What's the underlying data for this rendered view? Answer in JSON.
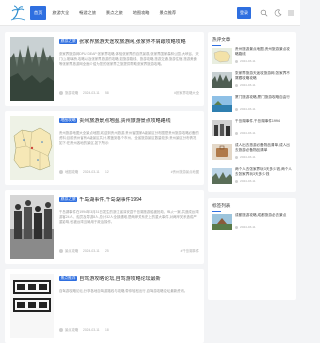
{
  "nav": {
    "items": [
      "首页",
      "旅游大全",
      "畅游之旅",
      "景点之旅",
      "地图攻略",
      "景点推荐"
    ],
    "login": "登录"
  },
  "posts": [
    {
      "category": "旅游之旅",
      "title": "张家界旅游天途攻旅游网,张家界不屑跟攻略攻略",
      "excerpt": "张家界旅游网DPU DEAP 张家界攻略,体验张家界的自然景观,张家界国家森林公园,大峡谷、天门山,玻璃桥,攻略以及张家界旅游的攻略;如旅游路线、旅游攻略,旅游交通,旅游住宿,旅游美食等张家界旅游网全面介绍为您的张家界之旅提供帮助张家界旅游攻略。",
      "author": "旅游攻略",
      "date": "2024-03-11",
      "views": "58",
      "tag": "#张家界攻略大全"
    },
    {
      "category": "地图攻略",
      "title": "贵州旅游景点地图,贵州旅游景点攻略路线",
      "excerpt": "贵州旅游地图大全景点地图,欢迎到贵州旅游,贵州省国家A级景区分布图是贵州旅游攻略必备的资料;目前贵州省有A级景区共计,覆盖到各个市州、全省旅游景区数量较多;贵州景区分布情况如下:在贵州各地的景区,如下所示:",
      "author": "地图攻略",
      "date": "2024-03-11",
      "views": "12",
      "tag": "#贵州旅游景点地图"
    },
    {
      "category": "旅游之旅",
      "title": "千岛湖事件,千岛湖事件1994",
      "excerpt": "千岛湖事件在1994年3月31日发生的浙江省淳安县千岛湖旅游船被抢劫、纵火一案,共造成台湾游客24人、船员及导游8人,总计32人全部遇难,是两岸关系史上的重大事件,对两岸关系造成严重影响,也被台湾当局用于政治操作。",
      "author": "景点攻略",
      "date": "2024-03-11",
      "views": "25",
      "tag": "#千岛湖事件"
    },
    {
      "category": "景点推荐",
      "title": "自驾游攻略论坛,自驾游攻略论坛最新",
      "excerpt": "自驾游攻略论坛,分享各地自驾游路线与攻略,带你轻松出行,自驾游攻略论坛最新资讯。",
      "author": "景点攻略",
      "date": "2024-03-11",
      "views": "18",
      "tag": ""
    }
  ],
  "sidebar": {
    "hot_title": "热评文章",
    "hot": [
      {
        "title": "贵州旅游景点地图,贵州旅游景点攻略路线",
        "date": "2024-03-11"
      },
      {
        "title": "张家界旅游天途攻旅游网,张家界不屑跟攻略攻略",
        "date": "2024-03-11"
      },
      {
        "title": "厦门旅游攻略,厦门旅游攻略自由行",
        "date": "2024-03-11"
      },
      {
        "title": "千岛湖事件,千岛湖事件1994",
        "date": "2024-03-11"
      },
      {
        "title": "成人出去旅游必备物品清单,成人出去旅游必备物品清单",
        "date": "2024-03-11"
      },
      {
        "title": "两个人去张家界玩3天多少钱,两个人去张家界玩3天多少钱",
        "date": "2024-03-11"
      }
    ],
    "tags_title": "标签列表",
    "tags_item": {
      "title": "成都旅游攻略,成都旅游必去景点",
      "date": "2024-03-11"
    }
  },
  "colors": {
    "accent": "#2f6fe0"
  }
}
